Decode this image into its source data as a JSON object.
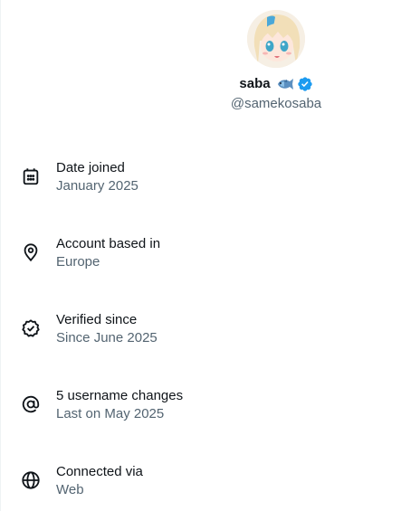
{
  "profile": {
    "display_name": "saba",
    "handle": "@samekosaba",
    "name_emoji_icon": "fish-icon",
    "verified_icon": "verified-badge-icon",
    "verified_color": "#1d9bf0"
  },
  "details": [
    {
      "icon": "calendar-icon",
      "title": "Date joined",
      "value": "January 2025"
    },
    {
      "icon": "location-pin-icon",
      "title": "Account based in",
      "value": "Europe"
    },
    {
      "icon": "verified-check-icon",
      "title": "Verified since",
      "value": "Since June 2025"
    },
    {
      "icon": "at-sign-icon",
      "title": "5 username changes",
      "value": "Last on May 2025"
    },
    {
      "icon": "globe-icon",
      "title": "Connected via",
      "value": "Web"
    }
  ],
  "colors": {
    "primary_text": "#0f1419",
    "secondary_text": "#536471",
    "accent_blue": "#1d9bf0"
  }
}
